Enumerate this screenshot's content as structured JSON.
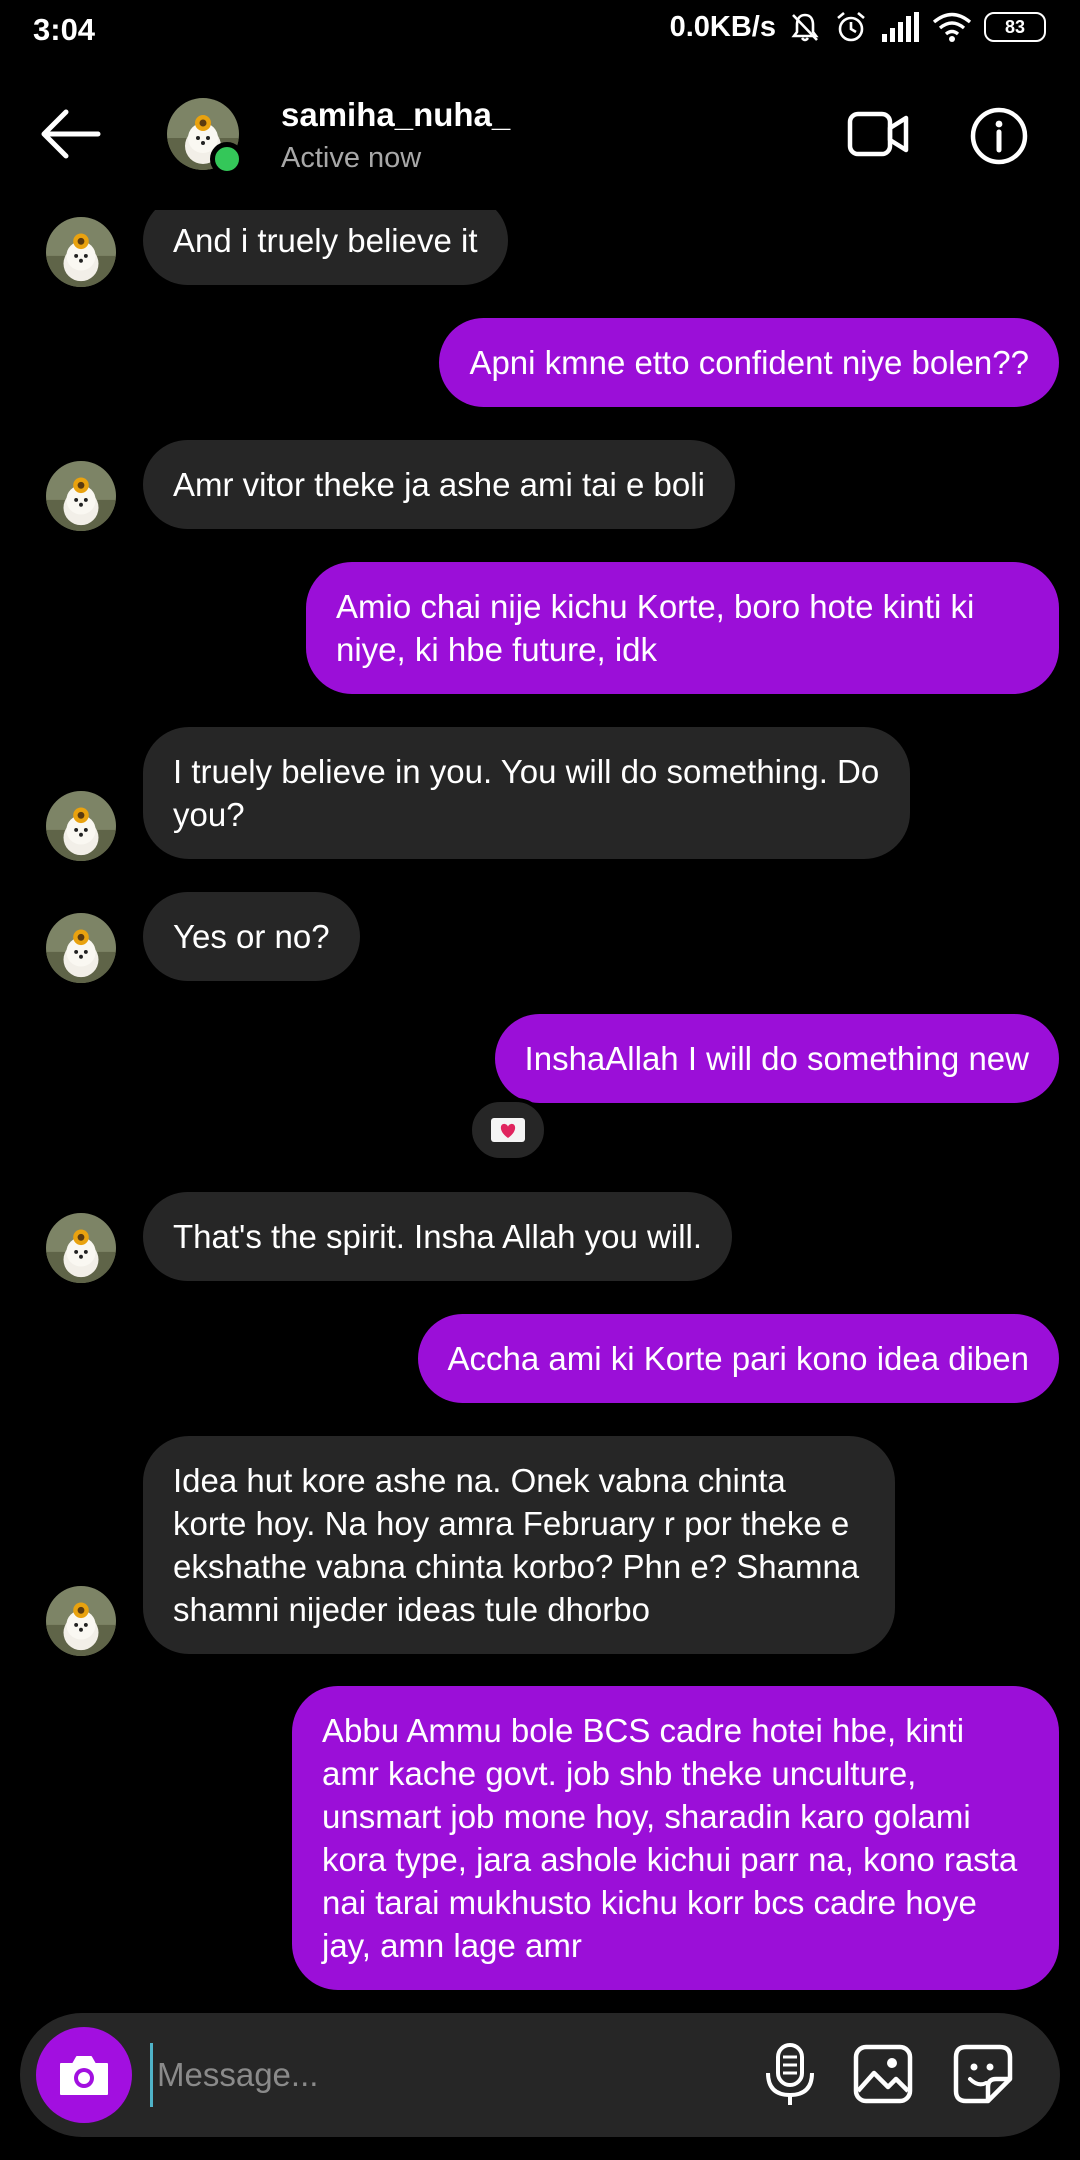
{
  "status_bar": {
    "time": "3:04",
    "net_speed": "0.0KB/s",
    "battery": "83"
  },
  "header": {
    "username": "samiha_nuha_",
    "status": "Active now"
  },
  "messages": [
    {
      "from": "them",
      "text": "And i truely believe it"
    },
    {
      "from": "me",
      "text": "Apni kmne etto confident niye bolen??"
    },
    {
      "from": "them",
      "text": "Amr vitor theke ja ashe ami tai e boli"
    },
    {
      "from": "me",
      "text": "Amio chai nije kichu Korte, boro hote kinti ki niye, ki hbe future, idk"
    },
    {
      "from": "them",
      "text": "I truely believe in you. You will do something. Do you?"
    },
    {
      "from": "them",
      "text": "Yes or no?"
    },
    {
      "from": "me",
      "text": "InshaAllah I will do something new"
    },
    {
      "from": "them",
      "text": "That's the spirit. Insha Allah you will."
    },
    {
      "from": "me",
      "text": "Accha ami ki Korte pari kono idea diben"
    },
    {
      "from": "them",
      "text": "Idea hut kore ashe na. Onek vabna chinta korte hoy. Na hoy amra February r por theke e ekshathe vabna chinta korbo? Phn e? Shamna shamni nijeder ideas tule dhorbo"
    },
    {
      "from": "me",
      "text": "Abbu Ammu bole BCS cadre hotei hbe, kinti amr kache govt. job shb theke unculture, unsmart job mone hoy, sharadin karo golami kora type, jara ashole kichui parr na, kono rasta nai tarai mukhusto kichu korr bcs cadre hoye jay, amn lage amr"
    }
  ],
  "reaction": {
    "emoji": "heart-envelope-icon"
  },
  "composer": {
    "placeholder": "Message..."
  },
  "colors": {
    "outgoing_bubble": "#9b0fd8",
    "incoming_bubble": "#262626",
    "online_dot": "#34c759",
    "camera_button": "#a20fe0"
  }
}
